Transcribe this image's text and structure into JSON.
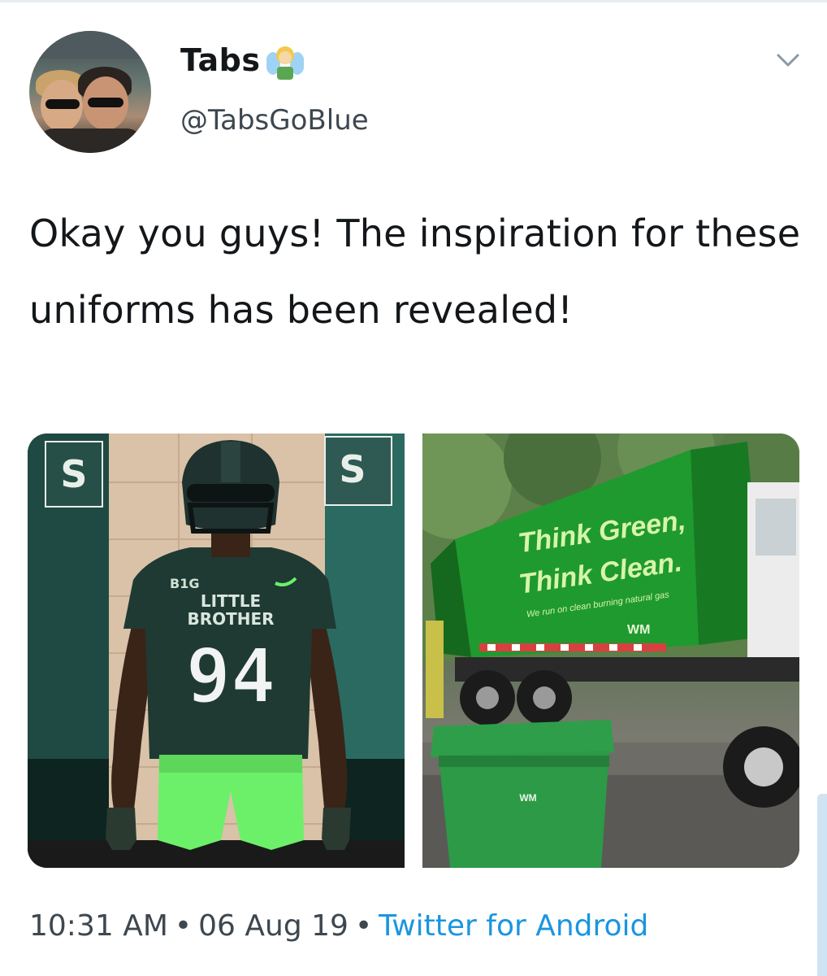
{
  "tweet": {
    "user_name": "Tabs",
    "name_emoji": "fairy-emoji",
    "handle": "@TabsGoBlue",
    "text": "Okay you guys! The inspiration for these uniforms has been revealed!",
    "time": "10:31 AM",
    "date": "06 Aug 19",
    "source": "Twitter for Android",
    "separator": "•"
  },
  "media": {
    "left_image": {
      "jersey_brand": "B1G",
      "jersey_line1": "LITTLE",
      "jersey_line2": "BROTHER",
      "jersey_number": "94",
      "banner_letter": "S"
    },
    "right_image": {
      "truck_line1": "Think Green,",
      "truck_line2": "Think Clean.",
      "truck_line3": "We run on clean burning natural gas",
      "truck_logo": "WM",
      "bin_logo": "WM"
    }
  },
  "colors": {
    "link": "#1b95e0",
    "text": "#14171a",
    "secondary": "#3d4750",
    "jersey_green": "#1f3a33",
    "pants_green": "#6cf06a",
    "truck_green": "#1e8c2a"
  }
}
